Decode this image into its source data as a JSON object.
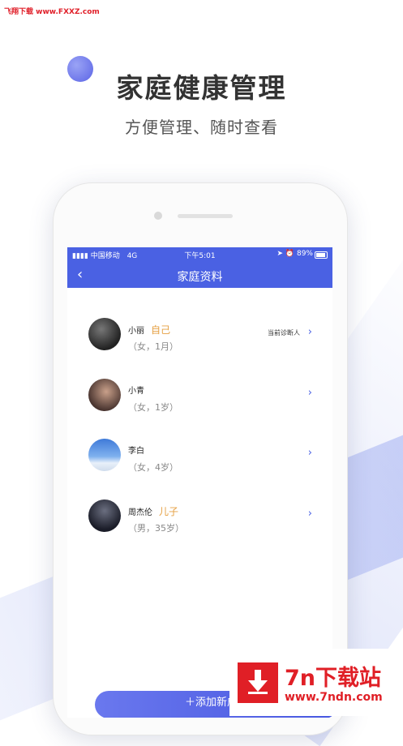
{
  "watermark": "飞翔下载 www.FXXZ.com",
  "promo": {
    "title": "家庭健康管理",
    "subtitle": "方便管理、随时查看"
  },
  "status_bar": {
    "carrier": "中国移动",
    "network": "4G",
    "time": "下午5:01",
    "battery": "89%"
  },
  "nav": {
    "back_icon": "‹",
    "title": "家庭资料"
  },
  "members": [
    {
      "name": "小丽",
      "tag": "自己",
      "info": "（女，1月）",
      "badge": "当前诊断人",
      "chevron": "›"
    },
    {
      "name": "小青",
      "tag": "",
      "info": "（女，1岁）",
      "badge": "",
      "chevron": "›"
    },
    {
      "name": "李白",
      "tag": "",
      "info": "（女，4岁）",
      "badge": "",
      "chevron": "›"
    },
    {
      "name": "周杰伦",
      "tag": "儿子",
      "info": "（男，35岁）",
      "badge": "",
      "chevron": "›"
    }
  ],
  "add_button": {
    "label": "＋添加新成员"
  },
  "site_logo": {
    "main": "7n下载站",
    "sub": "www.7ndn.com"
  },
  "colors": {
    "primary": "#4a61e3",
    "accent_tag": "#e5a043",
    "logo_red": "#e01f26"
  }
}
